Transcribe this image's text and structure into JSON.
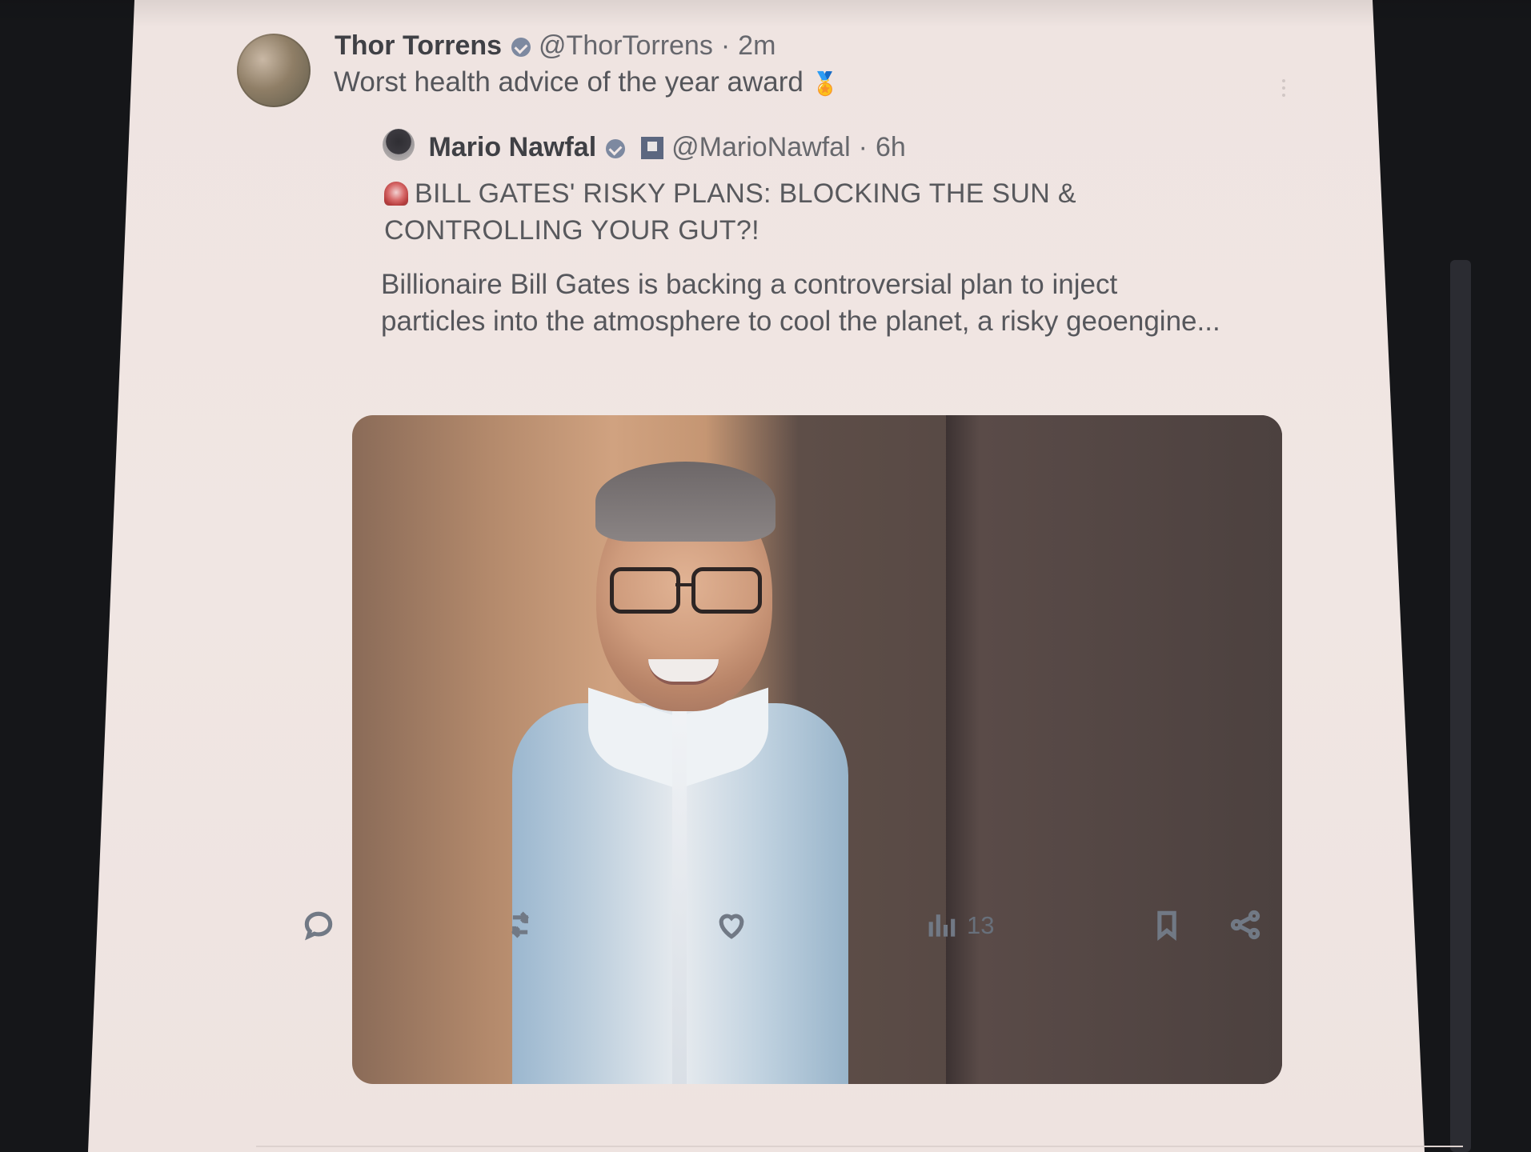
{
  "tweet": {
    "author_name": "Thor Torrens",
    "author_handle": "@ThorTorrens",
    "time": "2m",
    "text": "Worst health advice of the year award"
  },
  "quote": {
    "author_name": "Mario Nawfal",
    "author_handle": "@MarioNawfal",
    "time": "6h",
    "title_line1": "BILL GATES' RISKY PLANS: BLOCKING THE SUN &",
    "title_line2": "CONTROLLING YOUR GUT?!",
    "body_line1": "Billionaire Bill Gates is backing a controversial plan to inject",
    "body_line2": "particles into the atmosphere to cool the planet, a risky geoengine..."
  },
  "actions": {
    "views_count": "13"
  },
  "icons": {
    "verified": "verified-badge-icon",
    "medal": "medal-icon",
    "siren": "siren-icon",
    "reply": "reply-icon",
    "retweet": "retweet-icon",
    "like": "heart-icon",
    "views": "views-chart-icon",
    "bookmark": "bookmark-icon",
    "share": "share-icon",
    "more": "more-icon"
  }
}
